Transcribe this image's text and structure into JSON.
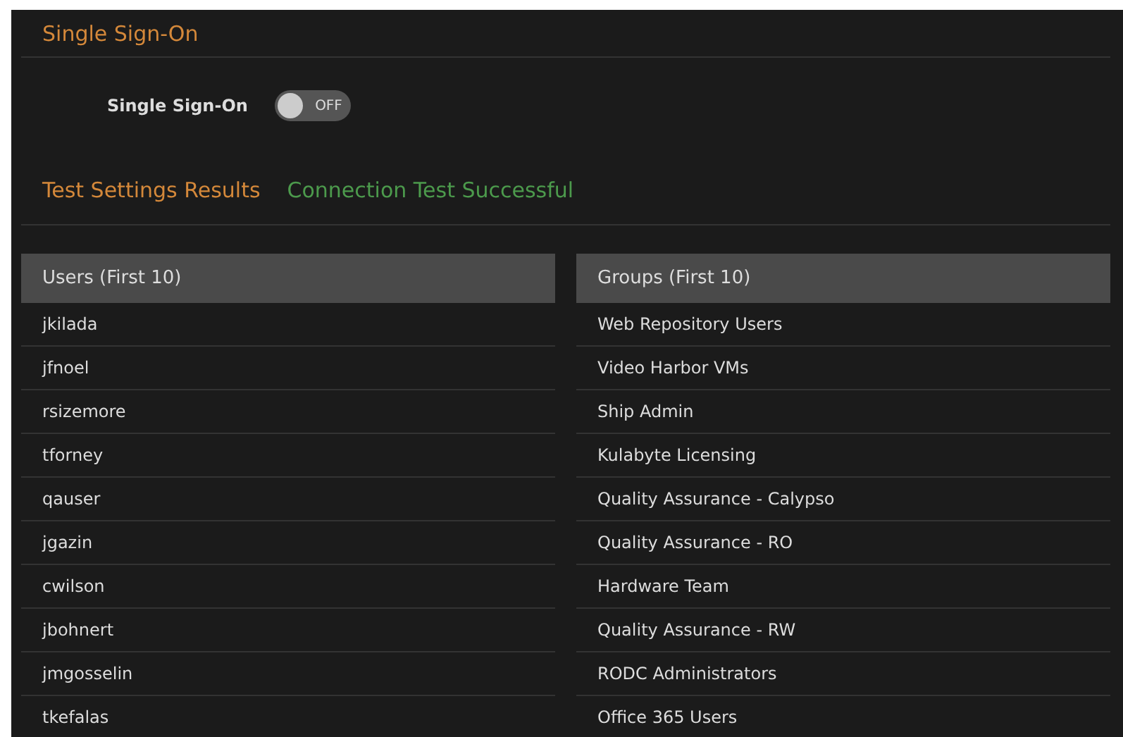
{
  "section_title": "Single Sign-On",
  "sso_toggle": {
    "label": "Single Sign-On",
    "on": false,
    "state_text": "OFF"
  },
  "test_results": {
    "title": "Test Settings Results",
    "status": "Connection Test Successful"
  },
  "tables": [
    {
      "header": "Users (First 10)",
      "rows": [
        "jkilada",
        "jfnoel",
        "rsizemore",
        "tforney",
        "qauser",
        "jgazin",
        "cwilson",
        "jbohnert",
        "jmgosselin",
        "tkefalas"
      ]
    },
    {
      "header": "Groups (First 10)",
      "rows": [
        "Web Repository Users",
        "Video Harbor VMs",
        "Ship Admin",
        "Kulabyte Licensing",
        "Quality Assurance - Calypso",
        "Quality Assurance - RO",
        "Hardware Team",
        "Quality Assurance - RW",
        "RODC Administrators",
        "Office 365 Users"
      ]
    }
  ]
}
